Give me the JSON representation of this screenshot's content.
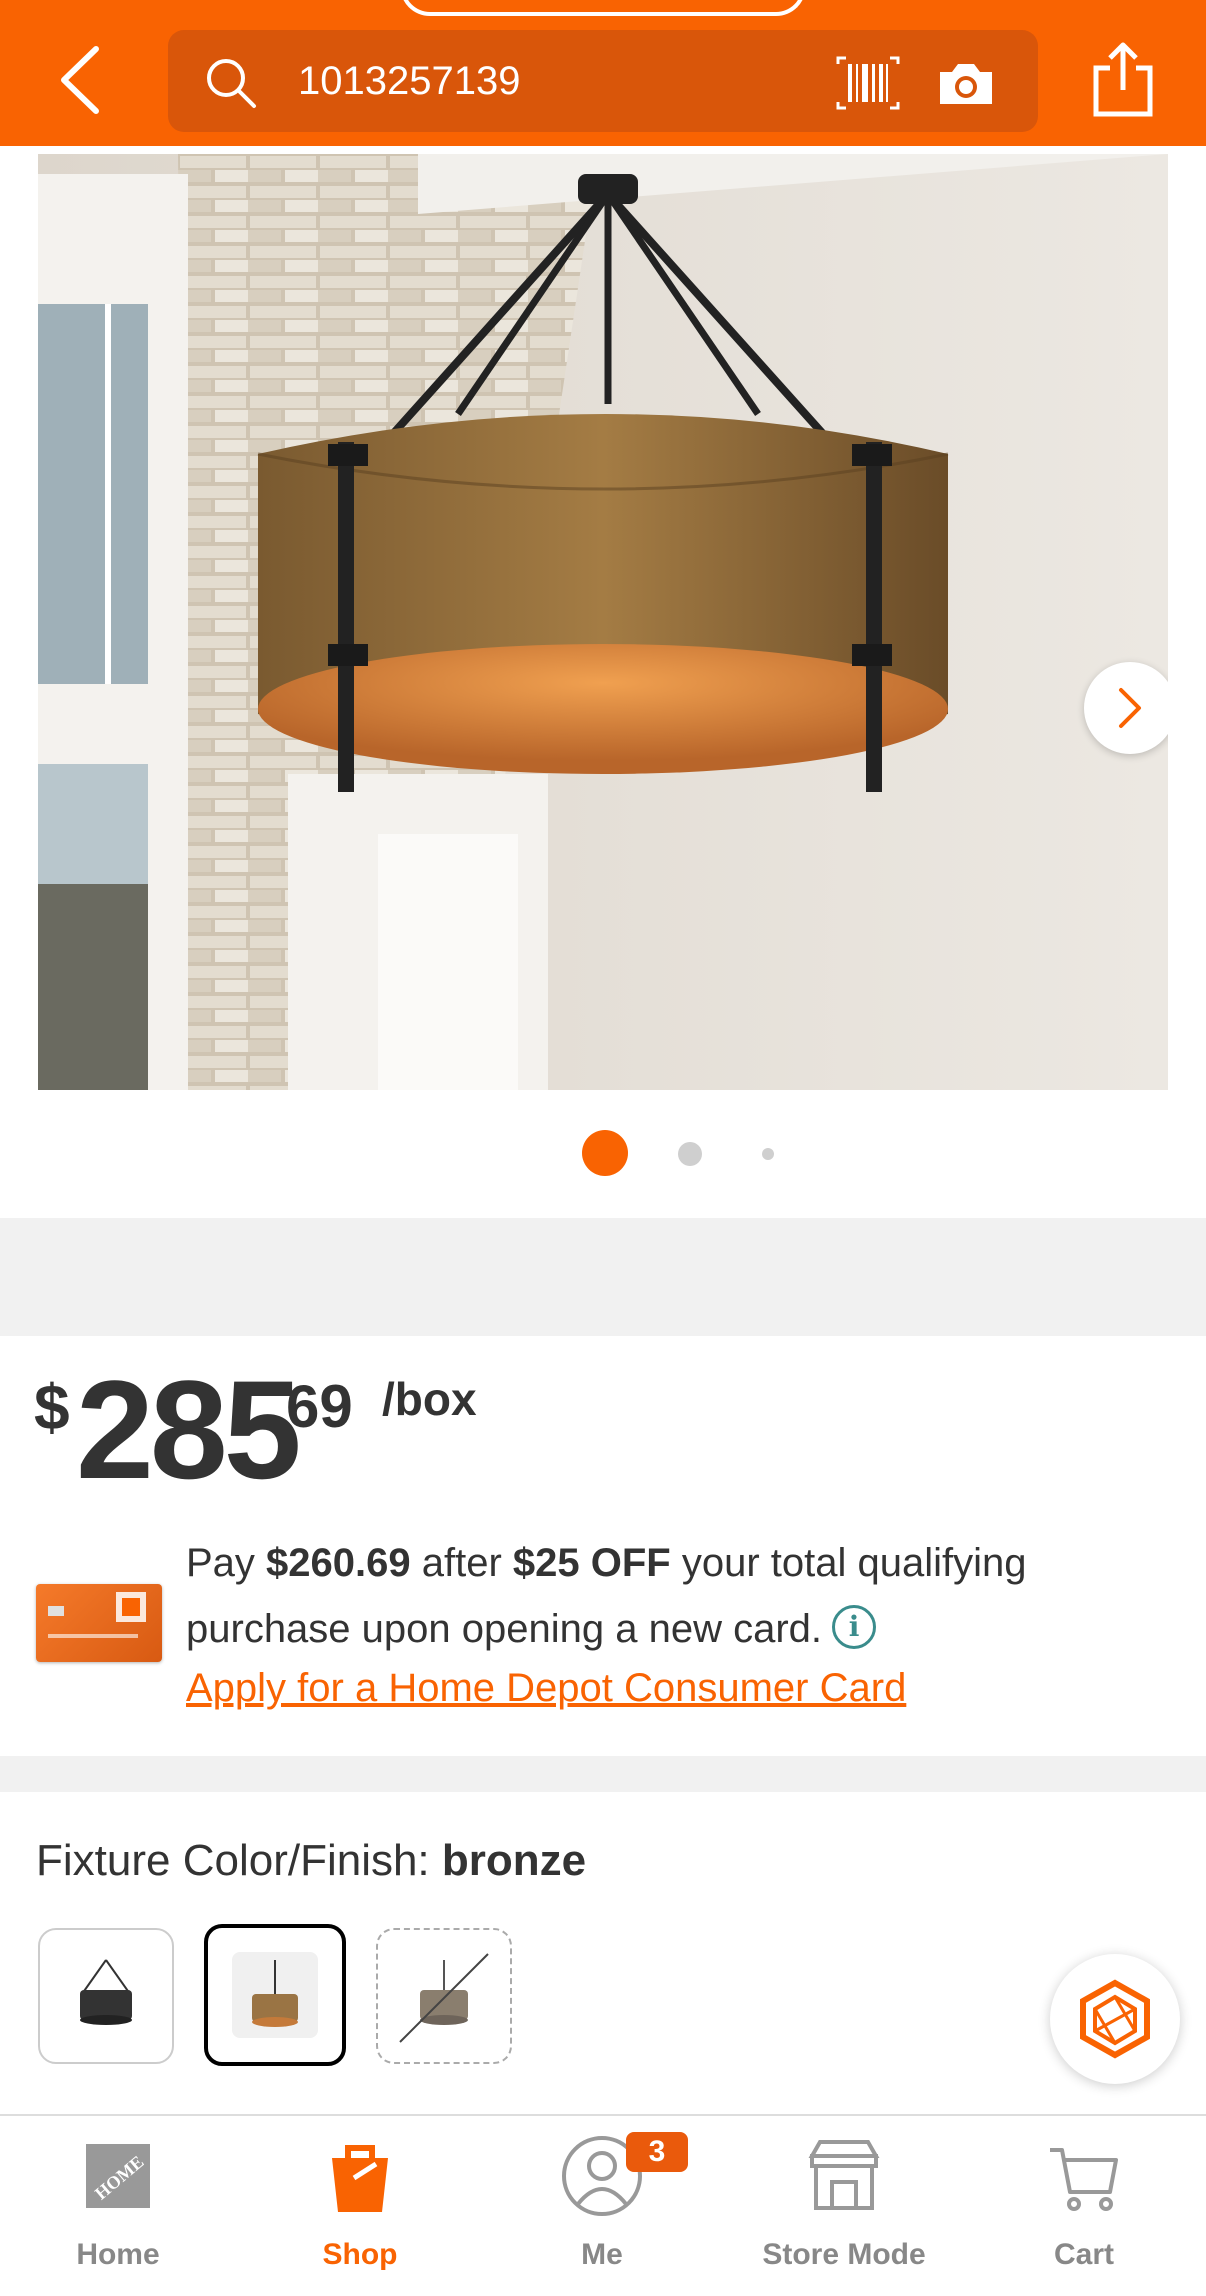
{
  "header": {
    "search_value": "1013257139",
    "back_icon": "chevron-left-icon",
    "barcode_icon": "barcode-icon",
    "camera_icon": "camera-icon",
    "share_icon": "share-icon"
  },
  "carousel": {
    "image_subject": "bronze drum pendant chandelier",
    "current_index": 1,
    "total": 3
  },
  "price": {
    "currency": "$",
    "whole": "285",
    "cents": "69",
    "unit": "/box"
  },
  "promo": {
    "text_pre": "Pay ",
    "discounted_price": "$260.69",
    "text_mid": " after ",
    "discount": "$25 OFF",
    "text_post": " your total qualifying purchase upon opening a new card.",
    "info_glyph": "i",
    "apply_link": "Apply for a Home Depot Consumer Card"
  },
  "finish": {
    "label": "Fixture Color/Finish: ",
    "value": "bronze",
    "swatches": [
      {
        "name": "black",
        "state": "available"
      },
      {
        "name": "bronze",
        "state": "selected"
      },
      {
        "name": "wood",
        "state": "unavailable"
      }
    ]
  },
  "bottom_nav": {
    "items": [
      {
        "label": "Home",
        "icon": "home-depot-logo-icon",
        "active": false
      },
      {
        "label": "Shop",
        "icon": "shop-bag-icon",
        "active": true
      },
      {
        "label": "Me",
        "icon": "user-icon",
        "active": false,
        "badge": "3"
      },
      {
        "label": "Store Mode",
        "icon": "store-icon",
        "active": false
      },
      {
        "label": "Cart",
        "icon": "cart-icon",
        "active": false
      }
    ]
  },
  "colors": {
    "brand_orange": "#f96302",
    "header_search_bg": "#d9560a",
    "text": "#333333"
  }
}
